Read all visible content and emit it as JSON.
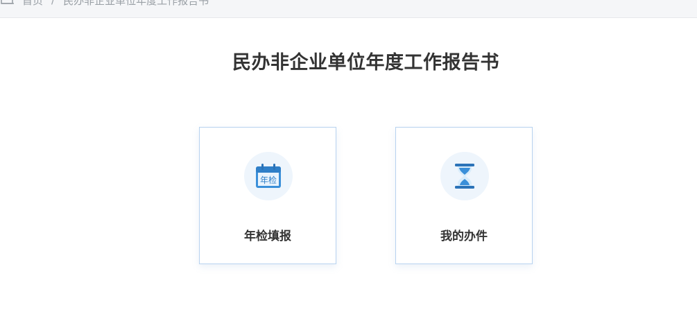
{
  "breadcrumb": {
    "home_label": "首页",
    "separator": "/",
    "current": "民办非企业单位年度工作报告书"
  },
  "page": {
    "title": "民办非企业单位年度工作报告书"
  },
  "cards": [
    {
      "label": "年检填报",
      "icon": "calendar-icon",
      "icon_text": "年检"
    },
    {
      "label": "我的办件",
      "icon": "hourglass-icon"
    }
  ],
  "colors": {
    "accent": "#3a8fd9",
    "card_border": "#b7d2ef",
    "icon_bg": "#eef5fc",
    "title_text": "#333333"
  }
}
